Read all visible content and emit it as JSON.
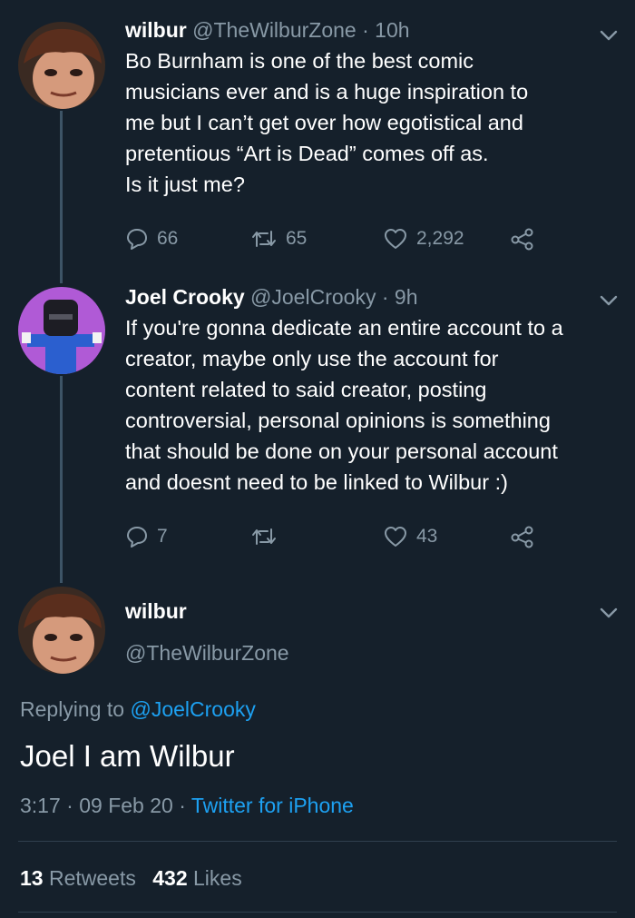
{
  "colors": {
    "background": "#15202b",
    "text": "#ffffff",
    "muted": "#8899a6",
    "link": "#1da1f2",
    "line": "#3d5466"
  },
  "tweet1": {
    "name": "wilbur",
    "handle": "@TheWilburZone",
    "sep": "·",
    "time": "10h",
    "lines": [
      "Bo Burnham is one of the best comic",
      "musicians ever and is a huge inspiration to",
      "me but I can’t get over how egotistical and",
      "pretentious “Art is Dead” comes off as.",
      "Is it just me?"
    ],
    "replies": "66",
    "retweets": "65",
    "likes": "2,292",
    "icons": [
      "reply-icon",
      "retweet-icon",
      "heart-icon",
      "share-icon",
      "chevron-down-icon"
    ]
  },
  "tweet2": {
    "name": "Joel Crooky",
    "handle": "@JoelCrooky",
    "sep": "·",
    "time": "9h",
    "lines": [
      "If you're gonna dedicate an entire account to a",
      "creator, maybe only use the account for",
      "content related to said creator, posting",
      "controversial, personal opinions is something",
      "that should be done on your personal account",
      "and doesnt need to be linked to Wilbur :)"
    ],
    "replies": "7",
    "likes": "43"
  },
  "main": {
    "name": "wilbur",
    "handle": "@TheWilburZone",
    "replying_prefix": "Replying to",
    "replying_handle": "@JoelCrooky",
    "text": "Joel I am Wilbur",
    "time": "3:17",
    "sep": "·",
    "date": "09 Feb 20",
    "sep2": "·",
    "client": "Twitter for iPhone",
    "retweets_count": "13",
    "retweets_label": "Retweets",
    "likes_count": "432",
    "likes_label": "Likes"
  }
}
